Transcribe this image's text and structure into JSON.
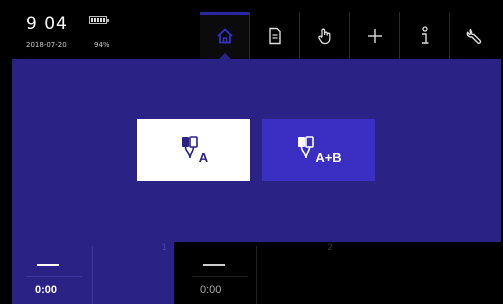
{
  "status": {
    "time": "9 04",
    "date": "2018-07-20",
    "battery_percent": "94%"
  },
  "nav": {
    "tabs": [
      {
        "icon": "home-icon",
        "active": true
      },
      {
        "icon": "document-icon",
        "active": false
      },
      {
        "icon": "hand-icon",
        "active": false
      },
      {
        "icon": "plus-icon",
        "active": false
      },
      {
        "icon": "info-icon",
        "active": false
      },
      {
        "icon": "wrench-icon",
        "active": false
      }
    ]
  },
  "electrode_mode": {
    "option_a": {
      "sub": "A",
      "icon": "electrode-pair-icon",
      "selected": true
    },
    "option_ab": {
      "sub": "A+B",
      "icon": "electrode-pair-icon",
      "selected": false
    }
  },
  "channels": [
    {
      "number": "1",
      "time": "0:00"
    },
    {
      "number": "2",
      "time": "0:00"
    }
  ],
  "colors": {
    "panel": "#2b2286",
    "accent": "#3a2fc2",
    "active_bar": "#2d26a3",
    "background": "#000000"
  }
}
